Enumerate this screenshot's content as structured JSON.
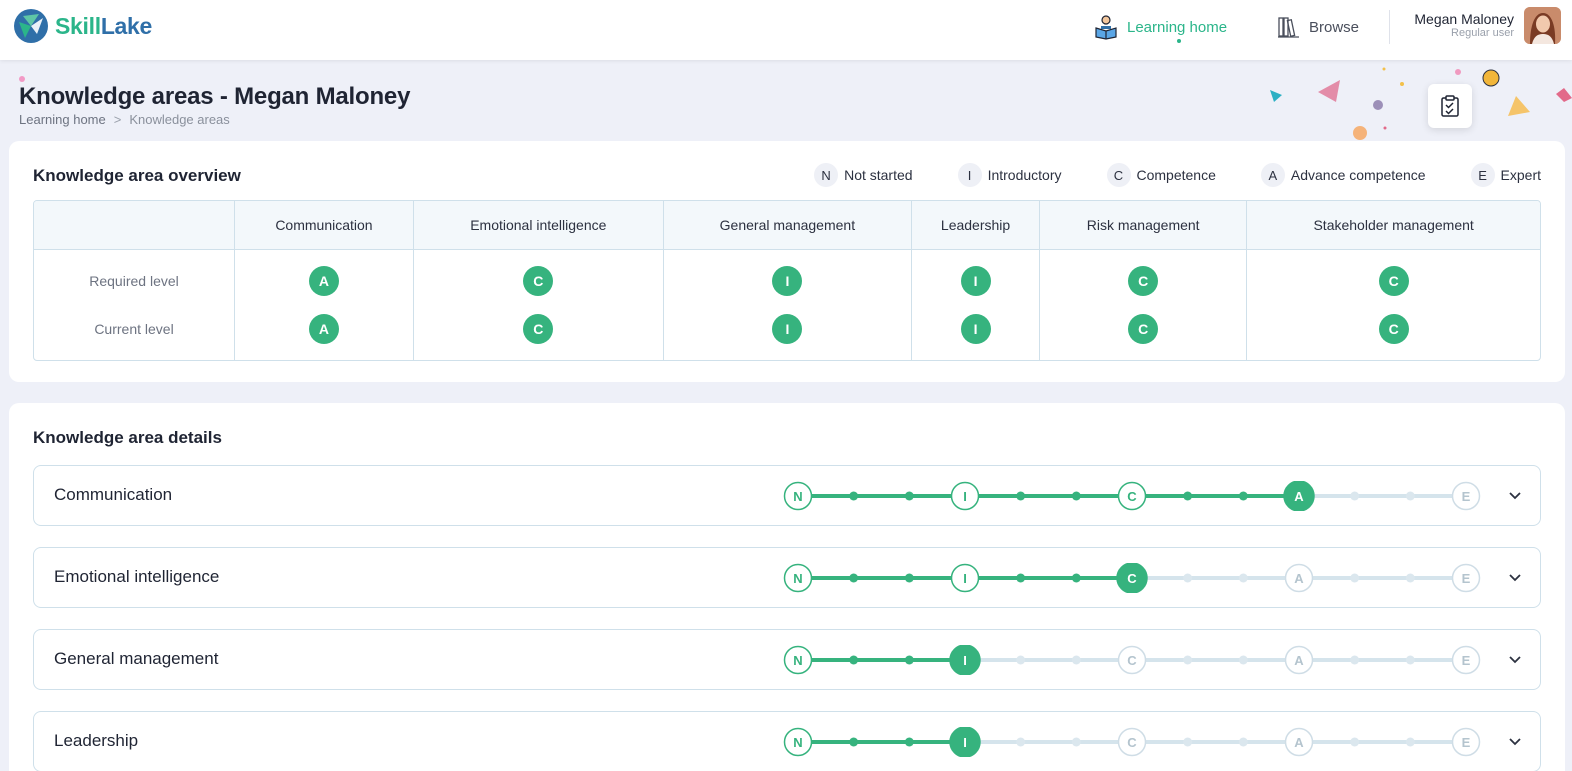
{
  "app": {
    "brand_part1": "Skill",
    "brand_part2": "Lake"
  },
  "nav": {
    "home_label": "Learning home",
    "browse_label": "Browse",
    "user_name": "Megan Maloney",
    "user_role": "Regular user"
  },
  "header": {
    "title": "Knowledge areas - Megan Maloney",
    "breadcrumb": [
      "Learning home",
      ">",
      "Knowledge areas"
    ]
  },
  "overview": {
    "title": "Knowledge area overview",
    "legend": [
      {
        "code": "N",
        "label": "Not started"
      },
      {
        "code": "I",
        "label": "Introductory"
      },
      {
        "code": "C",
        "label": "Competence"
      },
      {
        "code": "A",
        "label": "Advance competence"
      },
      {
        "code": "E",
        "label": "Expert"
      }
    ],
    "columns": [
      "Communication",
      "Emotional intelligence",
      "General management",
      "Leadership",
      "Risk management",
      "Stakeholder management"
    ],
    "rows": [
      {
        "label": "Required level",
        "values": [
          "A",
          "C",
          "I",
          "I",
          "C",
          "C"
        ]
      },
      {
        "label": "Current level",
        "values": [
          "A",
          "C",
          "I",
          "I",
          "C",
          "C"
        ]
      }
    ]
  },
  "details": {
    "title": "Knowledge area details",
    "levels": [
      "N",
      "I",
      "C",
      "A",
      "E"
    ],
    "items": [
      {
        "name": "Communication",
        "level_index": 3
      },
      {
        "name": "Emotional intelligence",
        "level_index": 2
      },
      {
        "name": "General management",
        "level_index": 1
      },
      {
        "name": "Leadership",
        "level_index": 1
      }
    ]
  },
  "colors": {
    "accent": "#36b37e",
    "brand_green": "#2bb58a",
    "brand_blue": "#2f6fa8",
    "track_inactive": "#d5e4ec",
    "border": "#cfe0ea"
  },
  "icons": {
    "logo": "skilllake-logo-icon",
    "home": "reading-person-icon",
    "browse": "books-icon",
    "checklist": "checklist-icon",
    "expand": "chevron-down-icon"
  }
}
